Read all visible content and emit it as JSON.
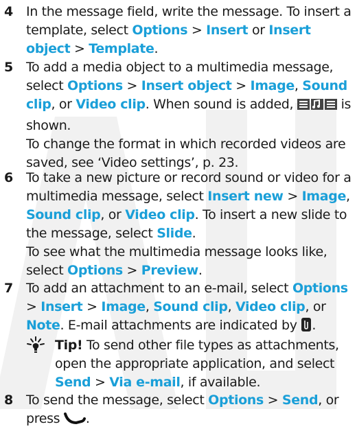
{
  "steps": [
    {
      "number": "4",
      "lines": [
        [
          "In the message field, write the message. To insert a template, select ",
          {
            "hl": "Options"
          },
          " > ",
          {
            "hl": "Insert"
          },
          " or ",
          {
            "hl": "Insert object"
          },
          " > ",
          {
            "hl": "Template"
          },
          "."
        ]
      ]
    },
    {
      "number": "5",
      "lines": [
        [
          "To add a media object to a multimedia message, select ",
          {
            "hl": "Options"
          },
          " > ",
          {
            "hl": "Insert object"
          },
          " > ",
          {
            "hl": "Image"
          },
          ", ",
          {
            "hl": "Sound clip"
          },
          ", or ",
          {
            "hl": "Video clip"
          },
          ". When sound is added, ",
          {
            "icon": "sound-clip-icon"
          },
          " is shown."
        ],
        [
          "To change the format in which recorded videos are saved, see ‘Video settings’, p. 23."
        ]
      ]
    },
    {
      "number": "6",
      "lines": [
        [
          "To take a new picture or record sound or video for a multimedia message, select ",
          {
            "hl": "Insert new"
          },
          " > ",
          {
            "hl": "Image"
          },
          ", ",
          {
            "hl": "Sound clip"
          },
          ", or ",
          {
            "hl": "Video clip"
          },
          ". To insert a new slide to the message, select ",
          {
            "hl": "Slide"
          },
          "."
        ],
        [
          "To see what the multimedia message looks like, select ",
          {
            "hl": "Options"
          },
          " > ",
          {
            "hl": "Preview"
          },
          "."
        ]
      ]
    },
    {
      "number": "7",
      "lines": [
        [
          "To add an attachment to an e-mail, select ",
          {
            "hl": "Options"
          },
          " > ",
          {
            "hl": "Insert"
          },
          " > ",
          {
            "hl": "Image"
          },
          ", ",
          {
            "hl": "Sound clip"
          },
          ", ",
          {
            "hl": "Video clip"
          },
          ", or ",
          {
            "hl": "Note"
          },
          ". E-mail attachments are indicated by ",
          {
            "icon": "attachment-icon"
          },
          "."
        ]
      ]
    },
    {
      "number": "8",
      "lines": [
        [
          "To send the message, select ",
          {
            "hl": "Options"
          },
          " > ",
          {
            "hl": "Send"
          },
          ", or press ",
          {
            "icon": "call-key-icon"
          },
          "."
        ]
      ]
    }
  ],
  "tip": {
    "icon": "tip-icon",
    "label": "Tip!",
    "text_parts": [
      " To send other file types as attachments, open the appropriate application, and select ",
      {
        "hl": "Send"
      },
      " > ",
      {
        "hl": "Via e-mail"
      },
      ", if available."
    ]
  },
  "colors": {
    "highlight": "#1a9fd8",
    "text": "#1a1a1a",
    "watermark": "#f3f3f3"
  }
}
